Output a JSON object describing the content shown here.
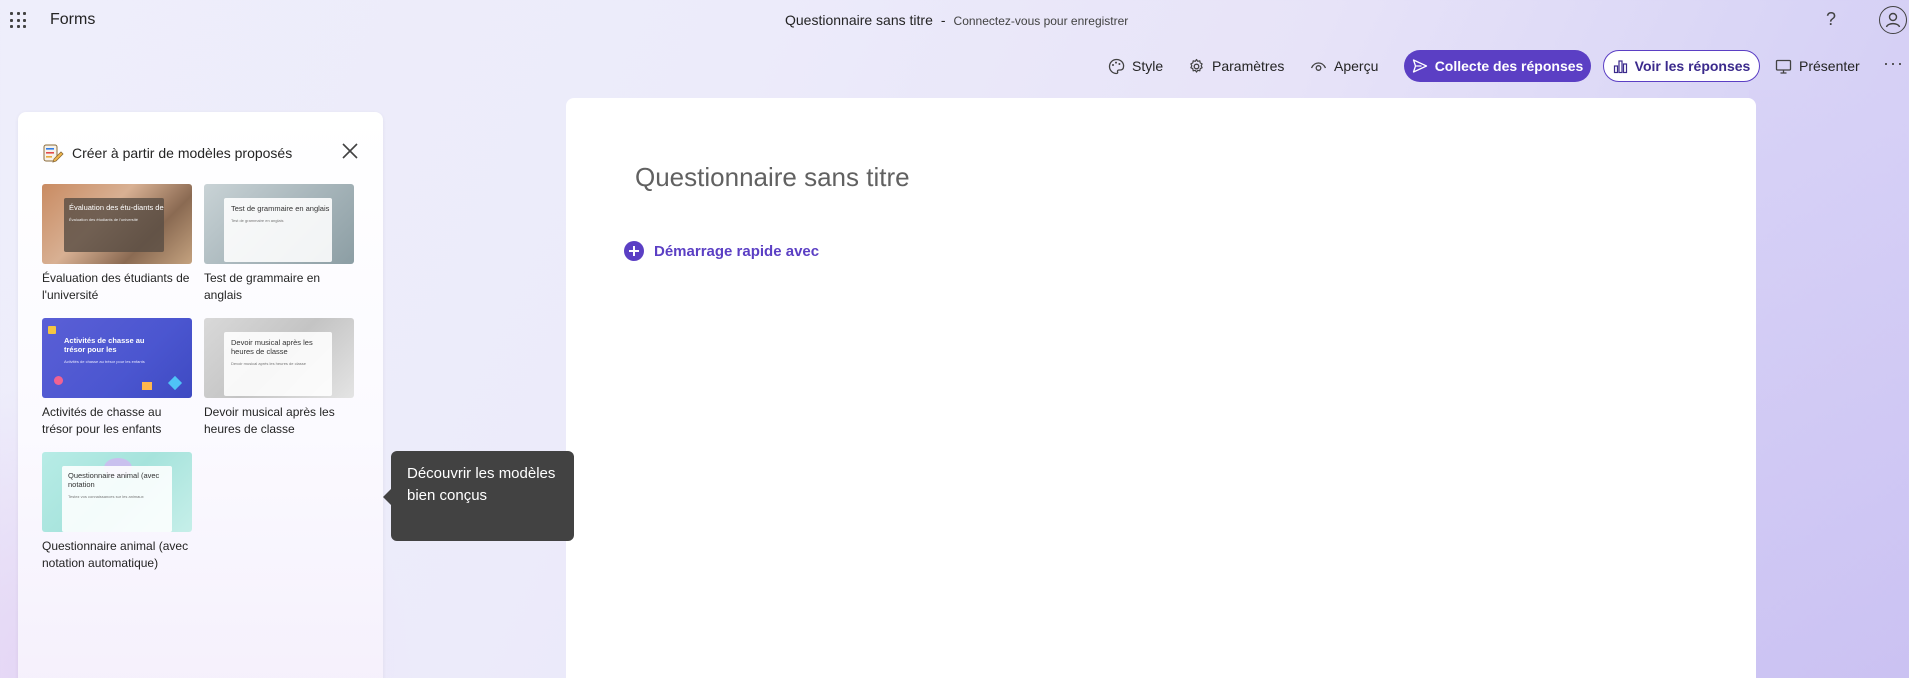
{
  "app": {
    "name": "Forms"
  },
  "header": {
    "title": "Questionnaire sans titre",
    "separator": "-",
    "subtitle": "Connectez-vous pour enregistrer",
    "help": "?"
  },
  "toolbar": {
    "style": "Style",
    "settings": "Paramètres",
    "preview": "Aperçu",
    "collect": "Collecte des réponses",
    "view_responses": "Voir les réponses",
    "present": "Présenter",
    "more": "···"
  },
  "templates_panel": {
    "title": "Créer à partir de modèles proposés",
    "items": [
      {
        "label": "Évaluation des étudiants de l'université",
        "thumb_title": "Évaluation des étu-diants de",
        "thumb_sub": "Évaluation des étudiants de l'université"
      },
      {
        "label": "Test de grammaire en anglais",
        "thumb_title": "Test de grammaire en anglais",
        "thumb_sub": "Test de grammaire en anglais"
      },
      {
        "label": "Activités de chasse au trésor pour les enfants",
        "thumb_title": "Activités de chasse au trésor pour les",
        "thumb_sub": "Activités de chasse au trésor pour les enfants"
      },
      {
        "label": "Devoir musical après les heures de classe",
        "thumb_title": "Devoir musical après les heures de classe",
        "thumb_sub": "Devoir musical après les heures de classe"
      },
      {
        "label": "Questionnaire animal (avec notation automatique)",
        "thumb_title": "Questionnaire animal (avec notation",
        "thumb_sub": "Testez vos connaissances sur les animaux"
      }
    ]
  },
  "tooltip": {
    "text": "Découvrir les modèles bien conçus"
  },
  "form": {
    "title": "Questionnaire sans titre",
    "quick_start": "Démarrage rapide avec"
  },
  "colors": {
    "accent": "#5b3fc4",
    "tooltip_bg": "#424242"
  }
}
